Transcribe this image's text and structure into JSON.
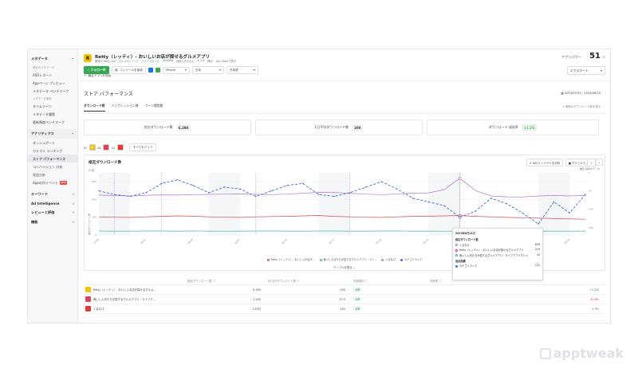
{
  "sidebar": {
    "sections": [
      {
        "label": "メタデータ",
        "groups": [
          {
            "label": "現在のメタデータ",
            "items": [
              "ASOレポート",
              "Appページ プレビュー",
              "メタデータ ベンチマーク"
            ]
          },
          {
            "label": "メタデータ更新",
            "items": [
              "タイムライン",
              "メタデータ履歴",
              "更新頻度ベンチマーク"
            ]
          }
        ]
      },
      {
        "label": "アナリティクス",
        "items": [
          "ダッシュボード",
          "カテゴリ ランキング",
          "ストア パフォーマンス",
          "コンバージョン 分析",
          "収益分析",
          "Appの内イベント"
        ],
        "badge": "NEW"
      },
      {
        "label": "キーワード"
      },
      {
        "label": "Ad Intelligence"
      },
      {
        "label": "レビューと評価"
      },
      {
        "label": "機能"
      }
    ]
  },
  "app": {
    "title": "Retty（レッティ）- おいしいお店が探せるグルメアプリ",
    "publisher": "開発元 Retty, Inc",
    "tag1": "グルメ&ドリンク",
    "tag2": "ライフスタイル",
    "tag3": "AppDNA",
    "tag4": "利用できません",
    "rating": "4.6",
    "price": "無料",
    "store_link": "App Storeで表示",
    "power_label": "アプリパワー",
    "power_value": "51"
  },
  "toolbar": {
    "follow": "フォロー中",
    "console": "コンソールを接続",
    "device": "iPhone",
    "country": "日本",
    "language": "日本語",
    "export": "エクスポート",
    "add_compare": "競合アプリを追加"
  },
  "section": {
    "title": "ストア パフォーマンス",
    "date_range": "2023/07/29 - 2023/08/29",
    "tabs": [
      "ダウンロード数",
      "インプレッション数",
      "ページ閲覧数"
    ],
    "history": "実際のダウンロード数を表示"
  },
  "kpis": [
    {
      "label": "合計ダウンロード数",
      "value": "6,390"
    },
    {
      "label": "1日平均ダウンロード数",
      "value": "200"
    },
    {
      "label": "ダウンロード 成長率",
      "value": "+1.2%"
    }
  ],
  "chips": {
    "clear": "すべてをクリア"
  },
  "chart": {
    "title": "推定ダウンロード数",
    "aso_btn": "ASOインパクトを分析",
    "memo_btn": "グラフメモ",
    "legend_top": "推定 実際のデータ",
    "ylabel": "推定ダウンロード数",
    "toggle": "日",
    "table_btn": "テーブルを表示",
    "legend": [
      "Retty（レッティ）- おいしいお店が...",
      "食いしん坊たちが愛するグルメアプリ・ライ...",
      "ぐるなび",
      "カテゴリランク"
    ],
    "tooltip": {
      "date": "2023年8月21日",
      "sub1": "推定ダウンロード数",
      "rows": [
        {
          "name": "ぐるなび",
          "value": "639"
        },
        {
          "name": "Retty（レッティ）- おいしいお店が探せるグルメアプリ",
          "value": "219"
        },
        {
          "name": "食いしん坊たちが愛するグルメアプリ・ライフアプリグルメ",
          "value": "43"
        }
      ],
      "sub2": "追加指標",
      "rank_name": "カテゴリランク",
      "rank_value": "122"
    }
  },
  "chart_data": {
    "type": "line",
    "x": [
      "07/29",
      "07/30",
      "07/31",
      "08/01",
      "08/02",
      "08/03",
      "08/04",
      "08/05",
      "08/06",
      "08/07",
      "08/08",
      "08/09",
      "08/10",
      "08/11",
      "08/12",
      "08/13",
      "08/14",
      "08/15",
      "08/16",
      "08/17",
      "08/18",
      "08/19",
      "08/20",
      "08/21",
      "08/22",
      "08/23",
      "08/24",
      "08/25",
      "08/26",
      "08/27",
      "08/28",
      "08/29"
    ],
    "y_ticks_left": [
      "600",
      "400",
      "200",
      "0"
    ],
    "y_ticks_right": [
      "1",
      "50",
      "100",
      "150"
    ],
    "ylim_left": [
      0,
      700
    ],
    "ylim_right": [
      1,
      170
    ],
    "series": [
      {
        "name": "ぐるなび",
        "color": "#b573d6",
        "values": [
          450,
          445,
          440,
          448,
          452,
          450,
          455,
          458,
          460,
          462,
          458,
          455,
          460,
          470,
          480,
          478,
          470,
          460,
          455,
          460,
          470,
          475,
          510,
          639,
          500,
          440,
          430,
          428,
          440,
          445,
          440,
          445
        ]
      },
      {
        "name": "Retty（レッティ）- おいしいお店が...",
        "color": "#d9465a",
        "values": [
          205,
          200,
          198,
          205,
          210,
          215,
          212,
          205,
          200,
          198,
          205,
          208,
          210,
          215,
          220,
          210,
          205,
          200,
          198,
          205,
          210,
          212,
          215,
          219,
          210,
          205,
          198,
          195,
          190,
          185,
          180,
          178
        ]
      },
      {
        "name": "食いしん坊たちが愛するグルメアプリ・ライ...",
        "color": "#41b8a8",
        "values": [
          45,
          44,
          44,
          45,
          45,
          44,
          45,
          44,
          43,
          44,
          45,
          45,
          44,
          44,
          45,
          45,
          44,
          44,
          45,
          45,
          44,
          44,
          43,
          43,
          44,
          44,
          45,
          45,
          44,
          44,
          44,
          44
        ]
      },
      {
        "name": "カテゴリランク",
        "color": "#3b6fd8",
        "axis": "right",
        "values": [
          50,
          60,
          65,
          55,
          30,
          20,
          35,
          55,
          40,
          45,
          65,
          50,
          35,
          30,
          60,
          65,
          55,
          40,
          25,
          45,
          70,
          80,
          90,
          122,
          105,
          70,
          85,
          110,
          140,
          80,
          110,
          60
        ]
      }
    ],
    "annotations_x": [
      "07/30",
      "08/02",
      "08/08",
      "08/14",
      "08/21"
    ]
  },
  "table": {
    "headers": [
      "",
      "推定ダウンロード数",
      "1日平均ダウンロード数",
      "成長傾向",
      "成長率"
    ],
    "rows": [
      {
        "name": "Retty（レッティ）- おいしいお店が探せるグルメ...",
        "downloads": "6,390",
        "daily": "200",
        "trend": "上昇",
        "growth": "+1.2%",
        "icon_color": "#f5c400"
      },
      {
        "name": "食いしん坊たちが愛するグルメアプリ・ライフア...",
        "downloads": "1,200",
        "daily": "37.5",
        "trend": "上昇",
        "growth": "-20.8%",
        "icon_color": "#d9465a"
      },
      {
        "name": "ぐるなび",
        "downloads": "1.39万",
        "daily": "433",
        "trend": "上昇",
        "growth": "-5.9%",
        "icon_color": "#e03a3a"
      }
    ]
  },
  "brand": "apptweak"
}
